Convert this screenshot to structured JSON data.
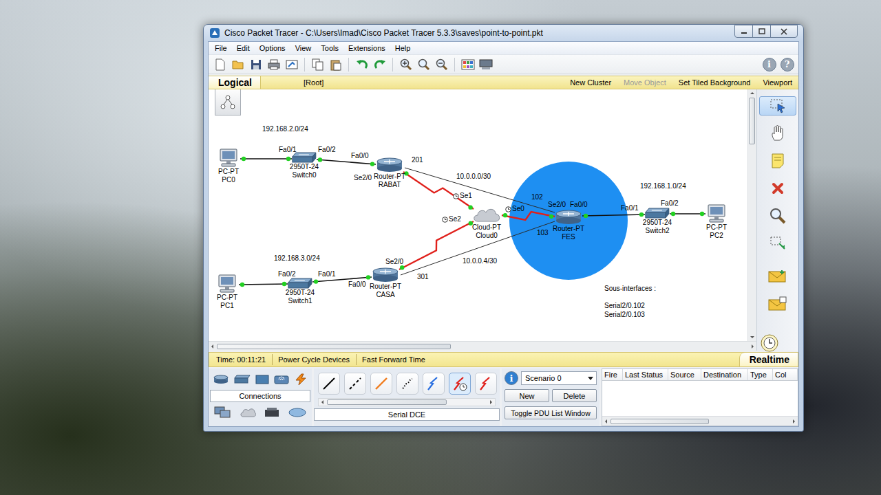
{
  "window": {
    "title": "Cisco Packet Tracer - C:\\Users\\Imad\\Cisco Packet Tracer 5.3.3\\saves\\point-to-point.pkt"
  },
  "menu": [
    "File",
    "Edit",
    "Options",
    "View",
    "Tools",
    "Extensions",
    "Help"
  ],
  "toolbar": {
    "info_icon": "i",
    "help_icon": "?"
  },
  "workspace_bar": {
    "mode": "Logical",
    "path": "[Root]",
    "actions": [
      {
        "label": "New Cluster",
        "disabled": false
      },
      {
        "label": "Move Object",
        "disabled": true
      },
      {
        "label": "Set Tiled Background",
        "disabled": false
      },
      {
        "label": "Viewport",
        "disabled": false
      }
    ]
  },
  "canvas": {
    "vertical_scroll": {
      "level": 0.2
    },
    "horizontal_scroll": {
      "level": 0.44
    }
  },
  "diagram": {
    "network_labels": [
      "192.168.2.0/24",
      "10.0.0.0/30",
      "192.168.1.0/24",
      "192.168.3.0/24",
      "10.0.0.4/30"
    ],
    "devices": [
      {
        "kind": "pc",
        "model": "PC-PT",
        "name": "PC0",
        "highlighted": false
      },
      {
        "kind": "switch",
        "model": "2950T-24",
        "name": "Switch0",
        "highlighted": false
      },
      {
        "kind": "router",
        "model": "Router-PT",
        "name": "RABAT",
        "highlighted": false
      },
      {
        "kind": "cloud",
        "model": "Cloud-PT",
        "name": "Cloud0",
        "highlighted": false
      },
      {
        "kind": "router",
        "model": "Router-PT",
        "name": "FES",
        "highlighted": true
      },
      {
        "kind": "switch",
        "model": "2950T-24",
        "name": "Switch2",
        "highlighted": false
      },
      {
        "kind": "pc",
        "model": "PC-PT",
        "name": "PC2",
        "highlighted": false
      },
      {
        "kind": "pc",
        "model": "PC-PT",
        "name": "PC1",
        "highlighted": false
      },
      {
        "kind": "switch",
        "model": "2950T-24",
        "name": "Switch1",
        "highlighted": false
      },
      {
        "kind": "router",
        "model": "Router-PT",
        "name": "CASA",
        "highlighted": false
      }
    ],
    "ports": [
      {
        "label": "Fa0/1",
        "clock": false
      },
      {
        "label": "Fa0/2",
        "clock": false
      },
      {
        "label": "Fa0/0",
        "clock": false
      },
      {
        "label": "Se2/0",
        "clock": false
      },
      {
        "label": "201",
        "clock": false
      },
      {
        "label": "Se1",
        "clock": true
      },
      {
        "label": "Se0",
        "clock": true
      },
      {
        "label": "Se2",
        "clock": true
      },
      {
        "label": "102",
        "clock": false
      },
      {
        "label": "Se2/0",
        "clock": false
      },
      {
        "label": "Fa0/0",
        "clock": false
      },
      {
        "label": "103",
        "clock": false
      },
      {
        "label": "Fa0/1",
        "clock": false
      },
      {
        "label": "Fa0/2",
        "clock": false
      },
      {
        "label": "Fa0/2",
        "clock": false
      },
      {
        "label": "Fa0/1",
        "clock": false
      },
      {
        "label": "Fa0/0",
        "clock": false
      },
      {
        "label": "Se2/0",
        "clock": false
      },
      {
        "label": "301",
        "clock": false
      }
    ],
    "links": [
      {
        "kind": "ethernet"
      },
      {
        "kind": "ethernet"
      },
      {
        "kind": "serial"
      },
      {
        "kind": "serial"
      },
      {
        "kind": "ethernet"
      },
      {
        "kind": "ethernet"
      },
      {
        "kind": "ethernet"
      },
      {
        "kind": "ethernet"
      },
      {
        "kind": "serial"
      },
      {
        "kind": "virtual"
      },
      {
        "kind": "virtual"
      }
    ],
    "note": [
      "Sous-interfaces :",
      "Serial2/0.102",
      "Serial2/0.103"
    ]
  },
  "palette": {
    "tools": [
      {
        "selected": true
      },
      {
        "selected": false
      },
      {
        "selected": false
      },
      {
        "selected": false
      },
      {
        "selected": false
      },
      {
        "selected": false
      },
      {
        "selected": false
      },
      {
        "selected": false
      }
    ]
  },
  "time_bar": {
    "time": "Time: 00:11:21",
    "actions": [
      "Power Cycle Devices",
      "Fast Forward Time"
    ],
    "mode": "Realtime"
  },
  "device_types": {
    "category": "Connections"
  },
  "connections": {
    "selected_label": "Serial DCE",
    "scroll": {
      "level": 0.75
    },
    "types": [
      {
        "kind": "copper-straight",
        "selected": false
      },
      {
        "kind": "copper-cross",
        "selected": false
      },
      {
        "kind": "fiber",
        "selected": false
      },
      {
        "kind": "phone",
        "selected": false
      },
      {
        "kind": "coaxial",
        "selected": false
      },
      {
        "kind": "serial-dce",
        "selected": true
      },
      {
        "kind": "serial-dte",
        "selected": false
      }
    ]
  },
  "scenario": {
    "info_icon": "i",
    "value": "Scenario 0",
    "buttons": [
      "New",
      "Delete"
    ],
    "toggle": "Toggle PDU List Window"
  },
  "pdu_list": {
    "columns": [
      "Fire",
      "Last Status",
      "Source",
      "Destination",
      "Type",
      "Col"
    ],
    "scroll": {
      "level": 0.55
    }
  }
}
